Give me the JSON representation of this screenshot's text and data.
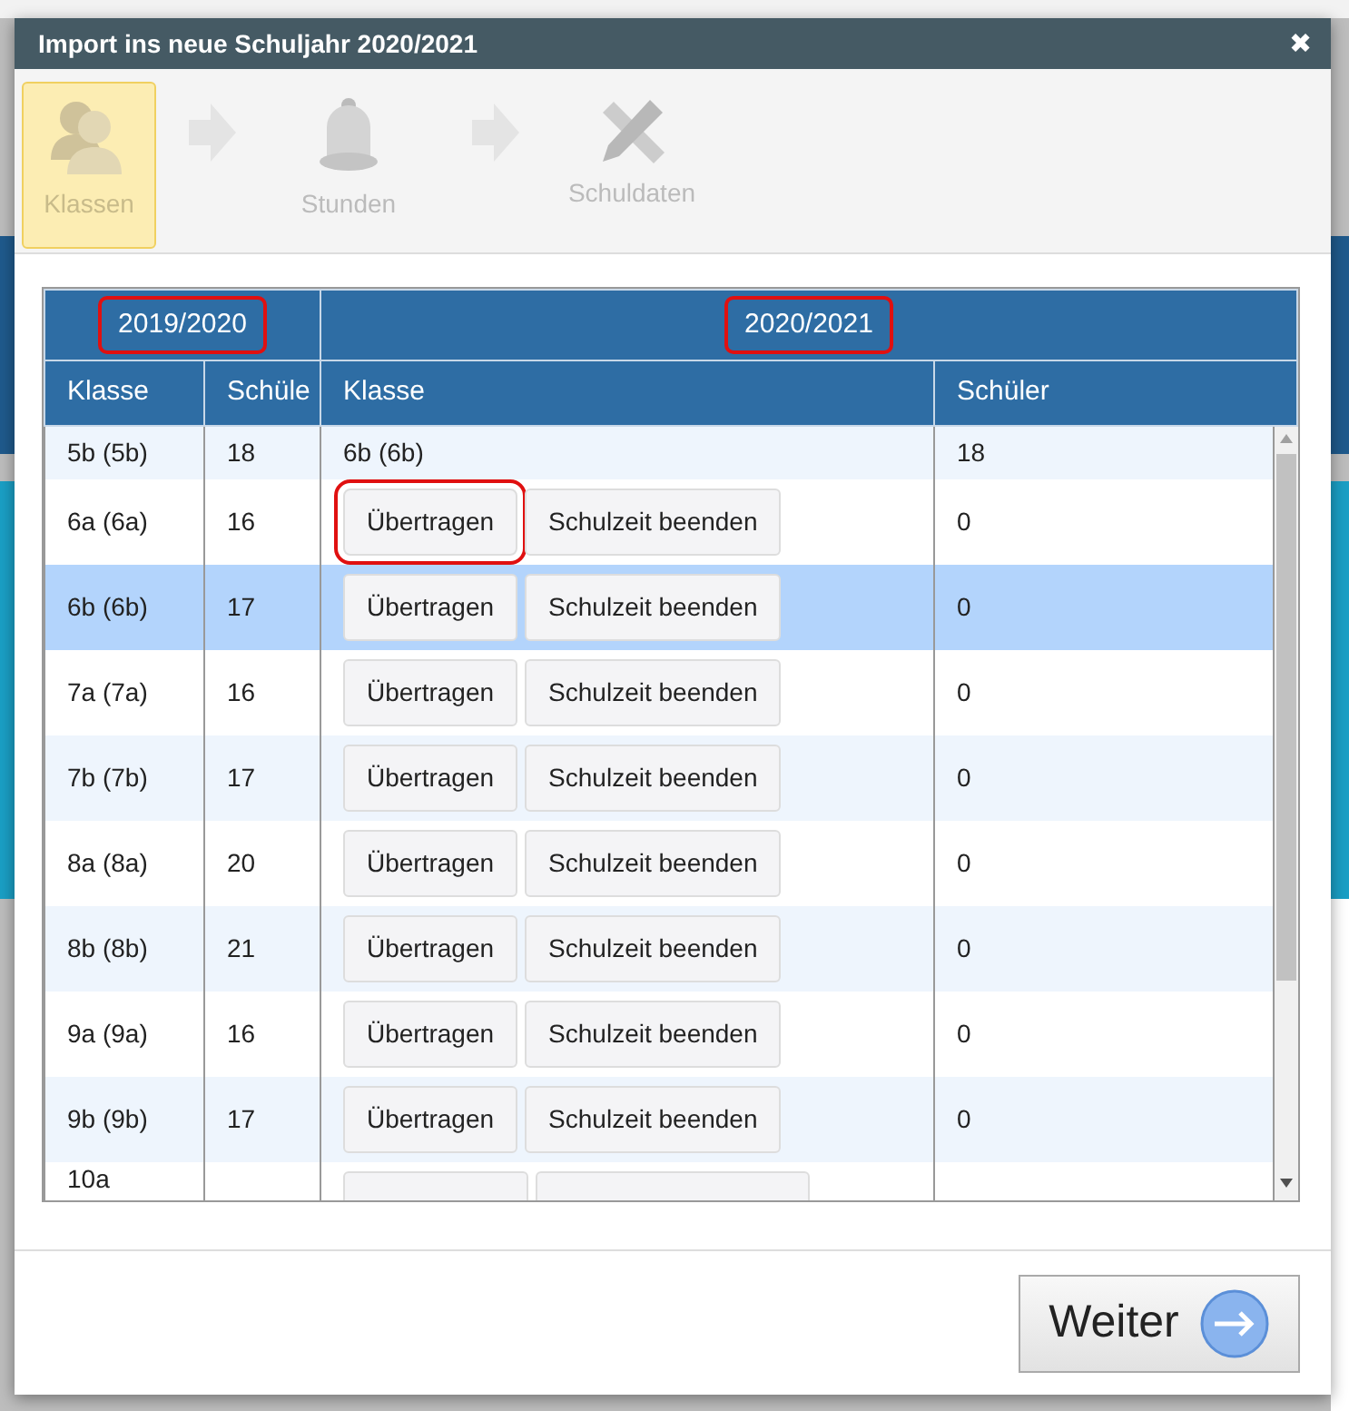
{
  "window": {
    "title": "Import ins neue Schuljahr 2020/2021",
    "close": "✖"
  },
  "steps": [
    {
      "label": "Klassen",
      "kind": "people",
      "selected": true
    },
    {
      "label": "Stunden",
      "kind": "bell",
      "selected": false
    },
    {
      "label": "Schuldaten",
      "kind": "tools",
      "selected": false
    }
  ],
  "table": {
    "groups": [
      {
        "label": "2019/2020",
        "highlighted": true
      },
      {
        "label": "2020/2021",
        "highlighted": true
      }
    ],
    "columns": [
      "Klasse",
      "Schüle",
      "Klasse",
      "Schüler"
    ],
    "rows": [
      {
        "kind": "done",
        "old_class": "5b (5b)",
        "old_students": "18",
        "new_class": "6b (6b)",
        "new_students": "18",
        "selected": false
      },
      {
        "kind": "pending",
        "old_class": "6a (6a)",
        "old_students": "16",
        "transfer": "Übertragen",
        "transfer_highlighted": true,
        "end": "Schulzeit beenden",
        "new_students": "0",
        "selected": false
      },
      {
        "kind": "pending",
        "old_class": "6b (6b)",
        "old_students": "17",
        "transfer": "Übertragen",
        "transfer_highlighted": false,
        "end": "Schulzeit beenden",
        "new_students": "0",
        "selected": true
      },
      {
        "kind": "pending",
        "old_class": "7a (7a)",
        "old_students": "16",
        "transfer": "Übertragen",
        "transfer_highlighted": false,
        "end": "Schulzeit beenden",
        "new_students": "0",
        "selected": false
      },
      {
        "kind": "pending",
        "old_class": "7b (7b)",
        "old_students": "17",
        "transfer": "Übertragen",
        "transfer_highlighted": false,
        "end": "Schulzeit beenden",
        "new_students": "0",
        "selected": false
      },
      {
        "kind": "pending",
        "old_class": "8a (8a)",
        "old_students": "20",
        "transfer": "Übertragen",
        "transfer_highlighted": false,
        "end": "Schulzeit beenden",
        "new_students": "0",
        "selected": false
      },
      {
        "kind": "pending",
        "old_class": "8b (8b)",
        "old_students": "21",
        "transfer": "Übertragen",
        "transfer_highlighted": false,
        "end": "Schulzeit beenden",
        "new_students": "0",
        "selected": false
      },
      {
        "kind": "pending",
        "old_class": "9a (9a)",
        "old_students": "16",
        "transfer": "Übertragen",
        "transfer_highlighted": false,
        "end": "Schulzeit beenden",
        "new_students": "0",
        "selected": false
      },
      {
        "kind": "pending",
        "old_class": "9b (9b)",
        "old_students": "17",
        "transfer": "Übertragen",
        "transfer_highlighted": false,
        "end": "Schulzeit beenden",
        "new_students": "0",
        "selected": false
      },
      {
        "kind": "cut",
        "old_class": "10a",
        "selected": false
      }
    ]
  },
  "footer": {
    "next": "Weiter"
  }
}
